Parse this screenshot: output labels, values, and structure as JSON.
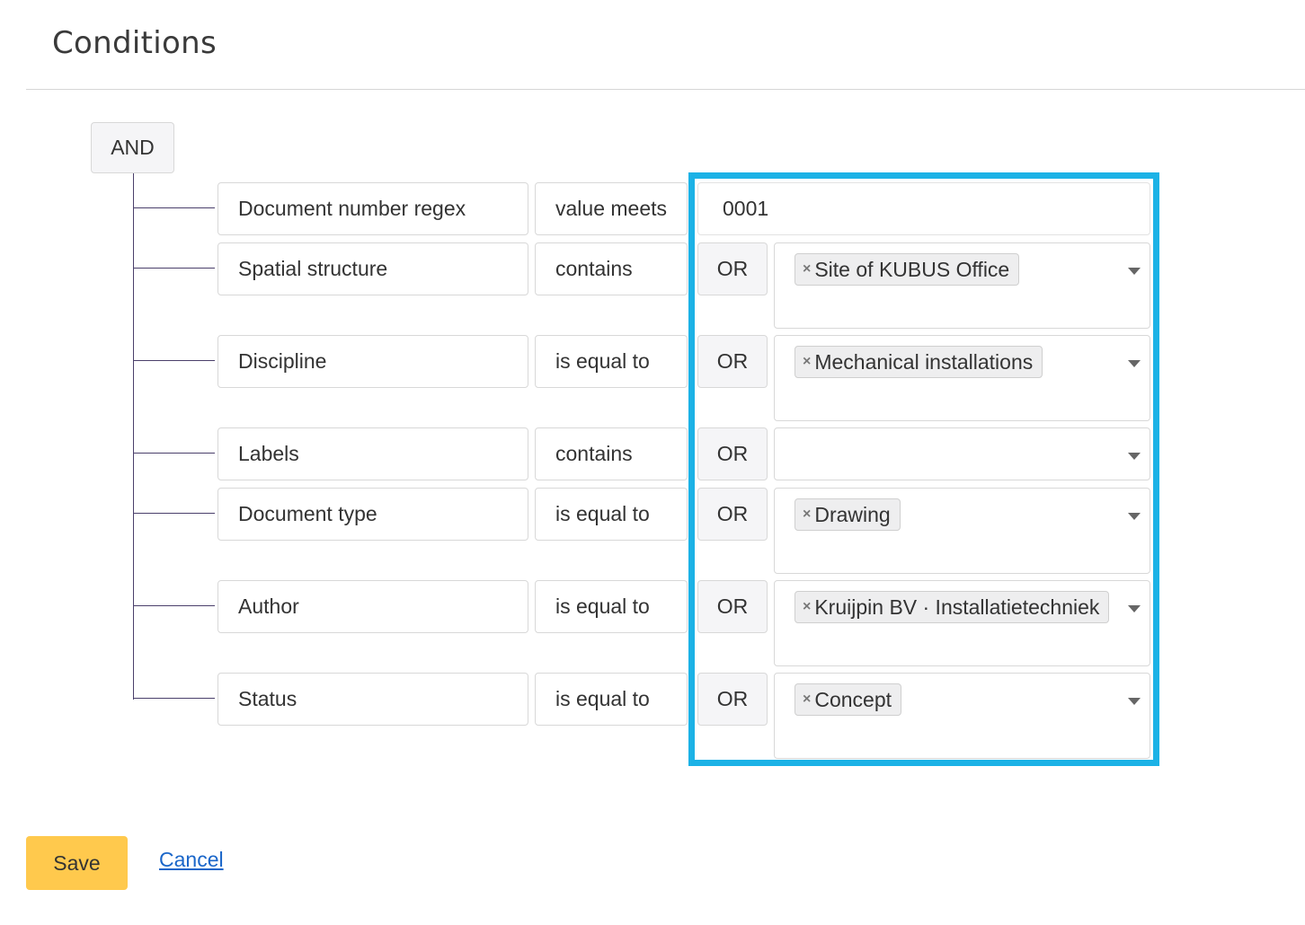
{
  "header": {
    "title": "Conditions"
  },
  "group": {
    "operator": "AND"
  },
  "rows": [
    {
      "field": "Document number regex",
      "operator": "value meets",
      "value_input": "0001"
    },
    {
      "field": "Spatial structure",
      "operator": "contains",
      "or_label": "OR",
      "tag": "Site of KUBUS Office"
    },
    {
      "field": "Discipline",
      "operator": "is equal to",
      "or_label": "OR",
      "tag": "Mechanical installations"
    },
    {
      "field": "Labels",
      "operator": "contains",
      "or_label": "OR"
    },
    {
      "field": "Document type",
      "operator": "is equal to",
      "or_label": "OR",
      "tag": "Drawing"
    },
    {
      "field": "Author",
      "operator": "is equal to",
      "or_label": "OR",
      "tag": "Kruijpin BV · Installatietechniek"
    },
    {
      "field": "Status",
      "operator": "is equal to",
      "or_label": "OR",
      "tag": "Concept"
    }
  ],
  "tag_remove_glyph": "×",
  "highlight_color": "#1cb2e6",
  "actions": {
    "save_label": "Save",
    "cancel_label": "Cancel"
  },
  "colors": {
    "save_button": "#ffc94d",
    "link": "#1a66c9"
  },
  "icons": {
    "dropdown": "chevron-down-icon",
    "remove": "close-icon"
  }
}
